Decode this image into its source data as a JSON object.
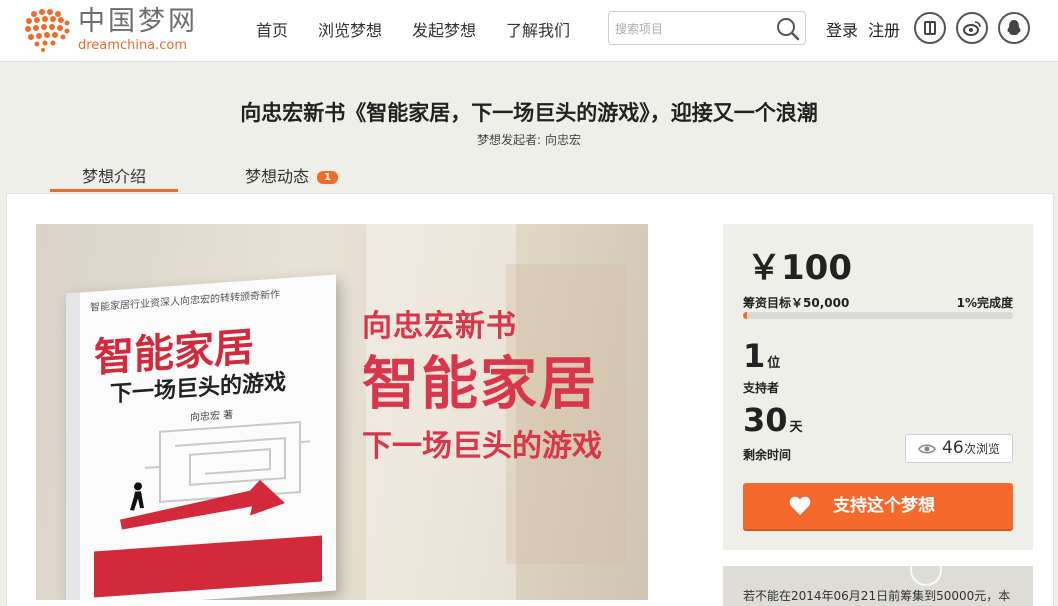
{
  "header": {
    "logo_cn": "中国梦网",
    "logo_en": "dreamchina.com",
    "nav": [
      "首页",
      "浏览梦想",
      "发起梦想",
      "了解我们"
    ],
    "search_placeholder": "搜索项目",
    "login": "登录",
    "register": "注册",
    "social_icons": [
      "renren-icon",
      "weibo-icon",
      "qq-icon"
    ]
  },
  "project": {
    "title": "向忠宏新书《智能家居，下一场巨头的游戏》，迎接又一个浪潮",
    "initiator_label": "梦想发起者:",
    "initiator_name": "向忠宏"
  },
  "tabs": [
    {
      "label": "梦想介绍",
      "active": true
    },
    {
      "label": "梦想动态",
      "badge": "1"
    }
  ],
  "hero": {
    "headline": "向忠宏新书",
    "title": "智能家居",
    "subtitle": "下一场巨头的游戏",
    "book_top": "智能家居行业资深人向忠宏的转转颁奇新作",
    "book_title": "智能家居",
    "book_subtitle": "下一场巨头的游戏",
    "book_author": "向忠宏 著"
  },
  "funding": {
    "amount": "￥100",
    "goal": "筹资目标￥50,000",
    "percent_label": "1%完成度",
    "progress": 0.01,
    "supporters_count": "1",
    "supporters_unit": "位",
    "supporters_label": "支持者",
    "days_remaining": "30",
    "days_unit": "天",
    "remaining_label": "剩余时间",
    "views_count": "46",
    "views_label": "次浏览",
    "support_button": "支持这个梦想",
    "note": "若不能在2014年06月21日前筹集到50000元，本"
  },
  "colors": {
    "accent": "#f06a2a",
    "button": "#f5692d",
    "hero_text": "#d8364a"
  }
}
